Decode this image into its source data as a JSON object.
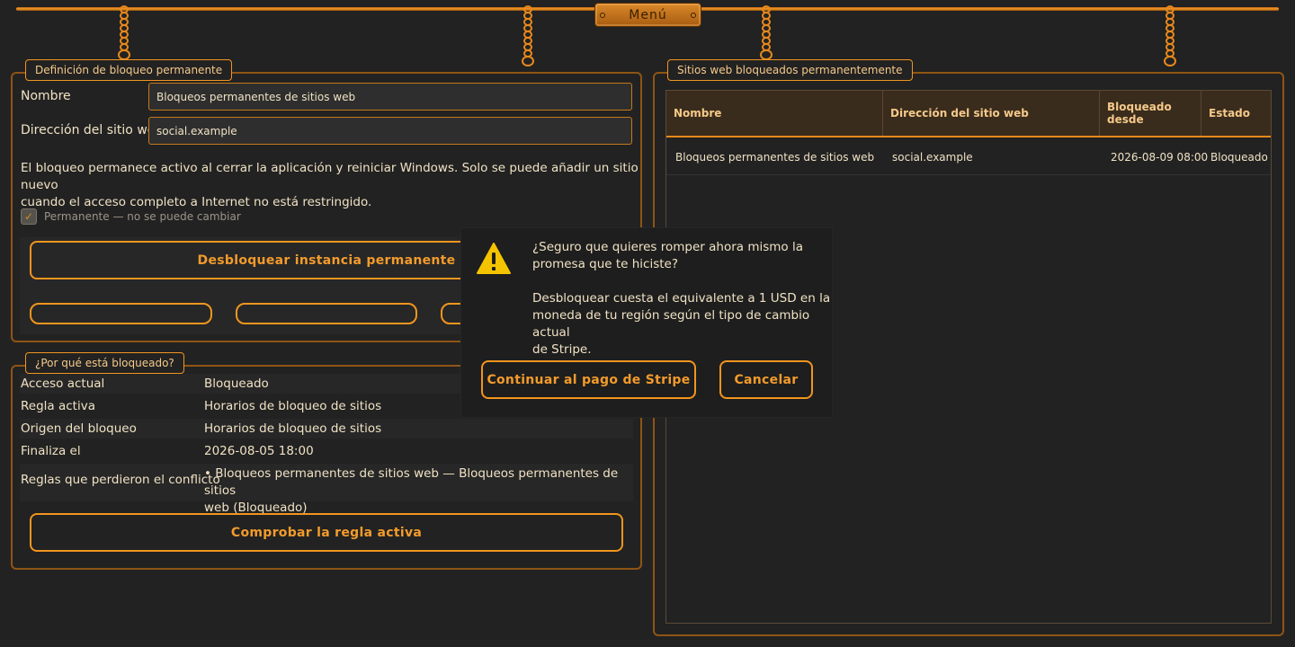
{
  "menu": {
    "label": "Menú"
  },
  "definition": {
    "tab": "Definición de bloqueo permanente",
    "name_label": "Nombre",
    "name_value": "Bloqueos permanentes de sitios web",
    "url_label": "Dirección del sitio web",
    "url_value": "social.example",
    "info_line1": "El bloqueo permanece activo al cerrar la aplicación y reiniciar Windows. Solo se puede añadir un sitio nuevo",
    "info_line2": "cuando el acceso completo a Internet no está restringido.",
    "permanent_label": "Permanente — no se puede cambiar",
    "permanent_checked": true,
    "unlock_button": "Desbloquear instancia permanente"
  },
  "why": {
    "tab": "¿Por qué está bloqueado?",
    "rows": [
      {
        "key": "Acceso actual",
        "value": "Bloqueado"
      },
      {
        "key": "Regla activa",
        "value": "Horarios de bloqueo de sitios"
      },
      {
        "key": "Origen del bloqueo",
        "value": "Horarios de bloqueo de sitios"
      },
      {
        "key": "Finaliza el",
        "value": "2026-08-05 18:00"
      }
    ],
    "conflict_key": "Reglas que perdieron el conflicto",
    "conflict_line1": "• Bloqueos permanentes de sitios web — Bloqueos permanentes de sitios",
    "conflict_line2": "web (Bloqueado)",
    "check_button": "Comprobar la regla activa"
  },
  "blocked_sites": {
    "tab": "Sitios web bloqueados permanentemente",
    "columns": [
      "Nombre",
      "Dirección del sitio web",
      "Bloqueado desde",
      "Estado"
    ],
    "rows": [
      [
        "Bloqueos permanentes de sitios web",
        "social.example",
        "2026-08-09 08:00",
        "Bloqueado"
      ]
    ]
  },
  "dialog": {
    "icon": "warning-icon",
    "question_line1": "¿Seguro que quieres romper ahora mismo la",
    "question_line2": "promesa que te hiciste?",
    "cost_line1": "Desbloquear cuesta el equivalente a 1 USD en la",
    "cost_line2": "moneda de tu región según el tipo de cambio actual",
    "cost_line3": "de Stripe.",
    "continue_button": "Continuar al pago de Stripe",
    "cancel_button": "Cancelar"
  },
  "colors": {
    "accent": "#f0951f",
    "background": "#222222",
    "text": "#f0e2c4",
    "warning": "#f5c400"
  }
}
